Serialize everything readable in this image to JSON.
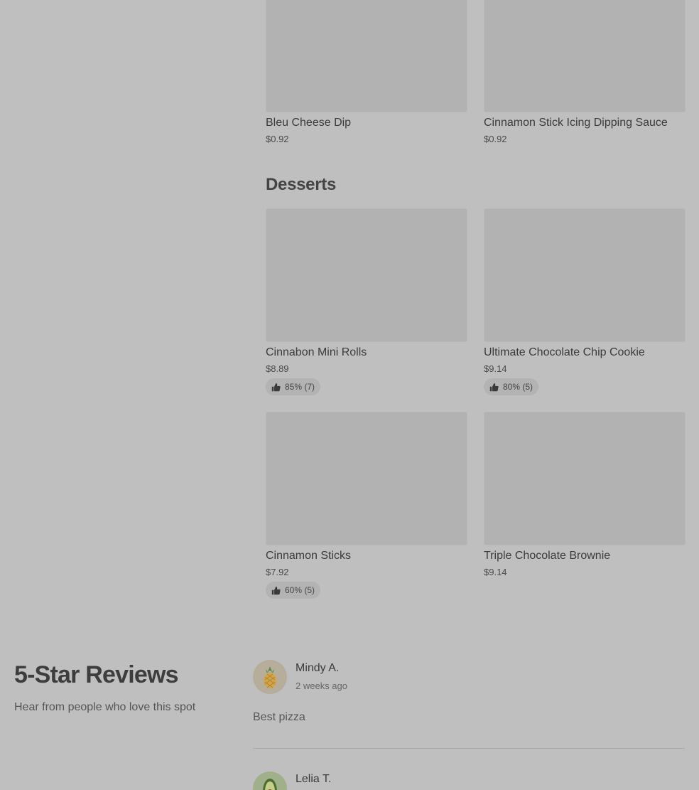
{
  "sides": {
    "items": [
      {
        "name": "Bleu Cheese Dip",
        "price": "$0.92"
      },
      {
        "name": "Cinnamon Stick Icing Dipping Sauce",
        "price": "$0.92"
      }
    ]
  },
  "desserts": {
    "title": "Desserts",
    "items": [
      {
        "name": "Cinnabon Mini Rolls",
        "price": "$8.89",
        "rating": "85% (7)"
      },
      {
        "name": "Ultimate Chocolate Chip Cookie",
        "price": "$9.14",
        "rating": "80% (5)"
      },
      {
        "name": "Cinnamon Sticks",
        "price": "$7.92",
        "rating": "60% (5)"
      },
      {
        "name": "Triple Chocolate Brownie",
        "price": "$9.14"
      }
    ]
  },
  "reviews": {
    "heading": "5-Star Reviews",
    "subheading": "Hear from people who love this spot",
    "items": [
      {
        "name": "Mindy A.",
        "time": "2 weeks ago",
        "text": "Best pizza",
        "avatar_icon": "pineapple-icon"
      },
      {
        "name": "Lelia T.",
        "avatar_icon": "avocado-icon"
      }
    ]
  },
  "colors": {
    "background": "#bfbfbf",
    "image_placeholder": "#b2b2b2",
    "pill_background": "#b3b3b3"
  }
}
